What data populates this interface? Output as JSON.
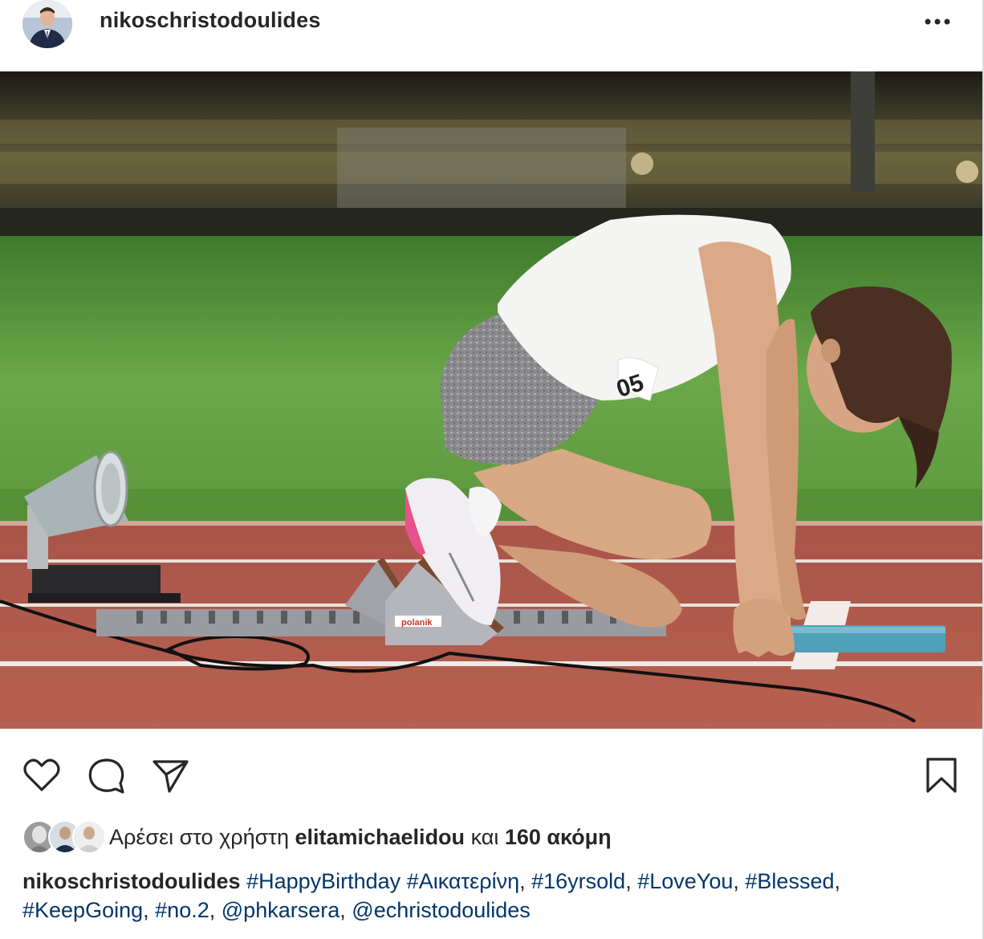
{
  "post": {
    "username": "nikoschristodoulides",
    "likes": {
      "prefix": "Αρέσει στο χρήστη",
      "liker": "elitamichaelidou",
      "connector": "και",
      "count_text": "160 ακόμη"
    },
    "caption": {
      "username": "nikoschristodoulides",
      "tags": [
        "#HappyBirthday",
        "#Αικατερίνη",
        "#16yrsold",
        "#LoveYou",
        "#Blessed",
        "#KeepGoing",
        "#no.2",
        "@phkarsera",
        "@echristodoulides"
      ]
    },
    "photo": {
      "brand_on_block": "polanik",
      "bib": "05"
    }
  },
  "icons": {
    "more": "more-options-icon",
    "like": "heart-icon",
    "comment": "comment-icon",
    "share": "send-icon",
    "save": "bookmark-icon"
  },
  "colors": {
    "text": "#262626",
    "tag": "#00376b",
    "track": "#b5574b",
    "grass": "#5f9a3c"
  }
}
